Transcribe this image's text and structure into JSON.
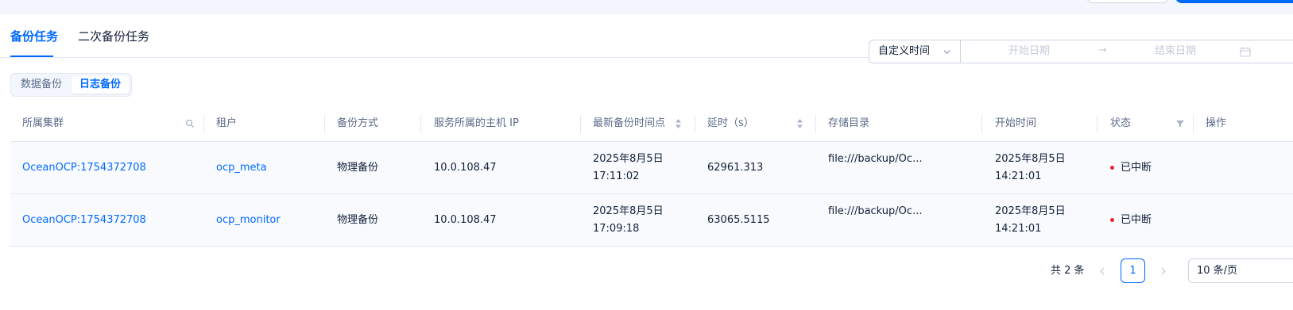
{
  "tabs": [
    {
      "label": "备份任务",
      "active": true
    },
    {
      "label": "二次备份任务",
      "active": false
    }
  ],
  "date_range": {
    "mode_label": "自定义时间",
    "start_placeholder": "开始日期",
    "separator": "→",
    "end_placeholder": "结束日期"
  },
  "segmented": [
    {
      "label": "数据备份",
      "active": false
    },
    {
      "label": "日志备份",
      "active": true
    }
  ],
  "table": {
    "columns": [
      {
        "label": "所属集群",
        "icon": "search-icon"
      },
      {
        "label": "租户"
      },
      {
        "label": "备份方式"
      },
      {
        "label": "服务所属的主机 IP"
      },
      {
        "label": "最新备份时间点",
        "sortable": true
      },
      {
        "label": "延时（s）",
        "sortable": true
      },
      {
        "label": "存储目录"
      },
      {
        "label": "开始时间"
      },
      {
        "label": "状态",
        "icon": "filter-icon"
      },
      {
        "label": "操作"
      }
    ],
    "rows": [
      {
        "cluster": "OceanOCP:1754372708",
        "tenant": "ocp_meta",
        "method": "物理备份",
        "host_ip": "10.0.108.47",
        "latest_backup_date": "2025年8月5日",
        "latest_backup_time": "17:11:02",
        "delay": "62961.313",
        "storage": "file:///backup/Oc...",
        "start_date": "2025年8月5日",
        "start_time": "14:21:01",
        "status": "已中断"
      },
      {
        "cluster": "OceanOCP:1754372708",
        "tenant": "ocp_monitor",
        "method": "物理备份",
        "host_ip": "10.0.108.47",
        "latest_backup_date": "2025年8月5日",
        "latest_backup_time": "17:09:18",
        "delay": "63065.5115",
        "storage": "file:///backup/Oc...",
        "start_date": "2025年8月5日",
        "start_time": "14:21:01",
        "status": "已中断"
      }
    ]
  },
  "pagination": {
    "total_text": "共 2 条",
    "current_page": "1",
    "page_size_label": "10 条/页"
  },
  "colors": {
    "primary": "#006aff",
    "status_interrupted": "#e8242e",
    "text": "#132039",
    "muted": "#5c6b8a"
  }
}
